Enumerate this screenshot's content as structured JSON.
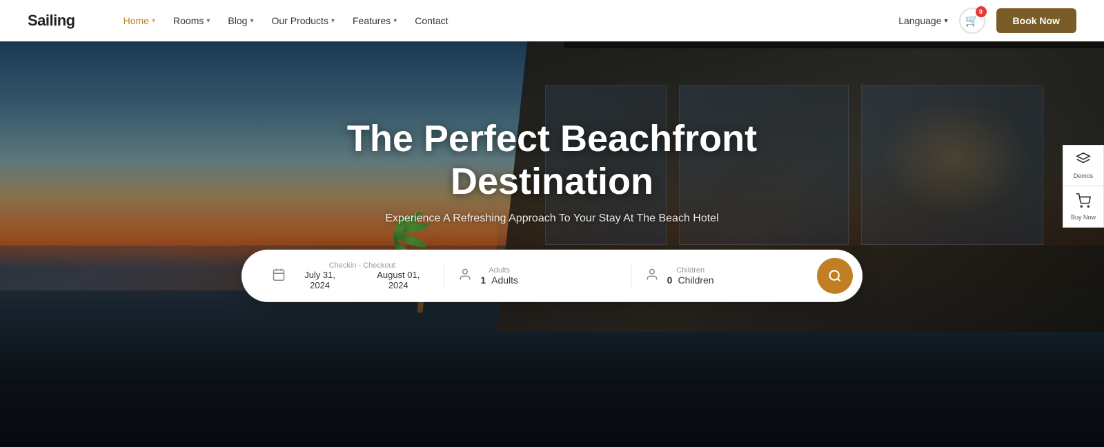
{
  "brand": "Sailing",
  "nav": {
    "links": [
      {
        "label": "Home",
        "active": true,
        "hasDropdown": true
      },
      {
        "label": "Rooms",
        "hasDropdown": true
      },
      {
        "label": "Blog",
        "hasDropdown": true
      },
      {
        "label": "Our Products",
        "hasDropdown": true
      },
      {
        "label": "Features",
        "hasDropdown": true
      },
      {
        "label": "Contact",
        "hasDropdown": false
      }
    ],
    "language": "Language",
    "cart_count": "0",
    "book_now": "Book Now"
  },
  "hero": {
    "title": "The Perfect Beachfront Destination",
    "subtitle": "Experience A Refreshing Approach To Your Stay At The Beach Hotel"
  },
  "search": {
    "checkin_label": "Checkin - Checkout",
    "checkin_date": "July 31, 2024",
    "checkout_date": "August 01, 2024",
    "adults_label": "Adults",
    "adults_count": "1",
    "adults_text": "Adults",
    "children_label": "Children",
    "children_count": "0",
    "children_text": "Children"
  },
  "side_panel": {
    "demos_label": "Demos",
    "buy_label": "Buy Now"
  },
  "colors": {
    "brand_brown": "#c17f24",
    "dark_brown": "#7a5c28",
    "nav_active": "#c17f24"
  }
}
